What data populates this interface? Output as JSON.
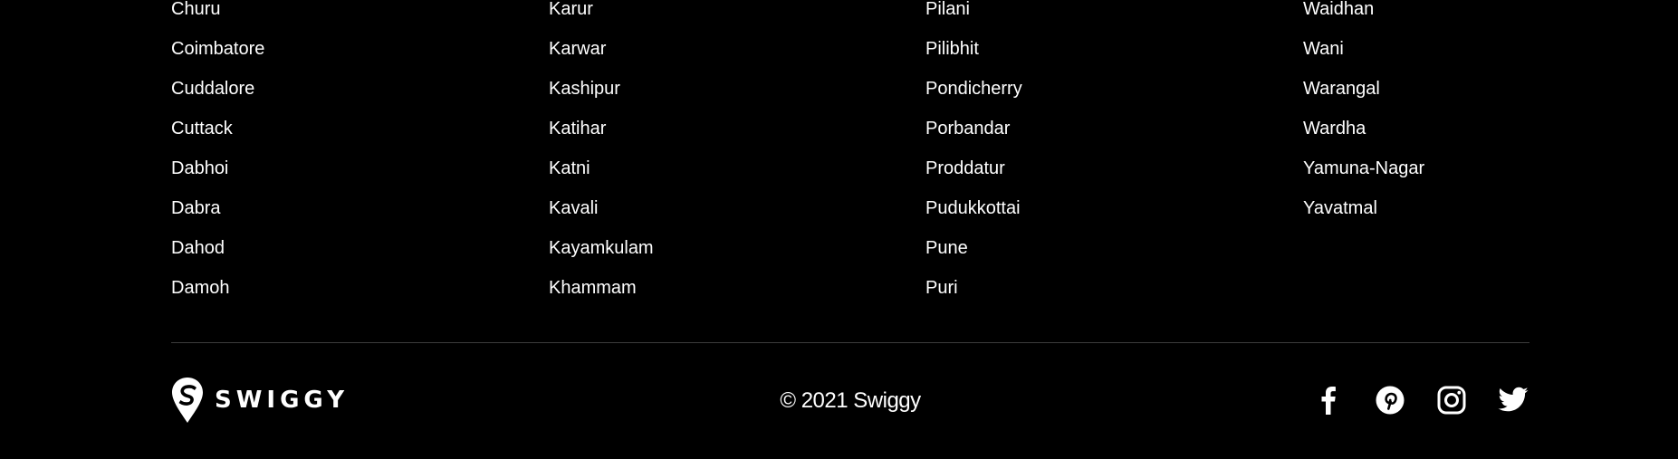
{
  "cities": {
    "col1": [
      "Churu",
      "Coimbatore",
      "Cuddalore",
      "Cuttack",
      "Dabhoi",
      "Dabra",
      "Dahod",
      "Damoh"
    ],
    "col2": [
      "Karur",
      "Karwar",
      "Kashipur",
      "Katihar",
      "Katni",
      "Kavali",
      "Kayamkulam",
      "Khammam"
    ],
    "col3": [
      "Pilani",
      "Pilibhit",
      "Pondicherry",
      "Porbandar",
      "Proddatur",
      "Pudukkottai",
      "Pune",
      "Puri"
    ],
    "col4": [
      "Waidhan",
      "Wani",
      "Warangal",
      "Wardha",
      "Yamuna-Nagar",
      "Yavatmal"
    ]
  },
  "footer": {
    "logo_text": "SWIGGY",
    "copyright": "© 2021 Swiggy",
    "social": [
      {
        "name": "facebook-icon"
      },
      {
        "name": "pinterest-icon"
      },
      {
        "name": "instagram-icon"
      },
      {
        "name": "twitter-icon"
      }
    ]
  },
  "colors": {
    "background": "#000000",
    "text": "#ffffff",
    "divider": "#3c3c3c"
  }
}
